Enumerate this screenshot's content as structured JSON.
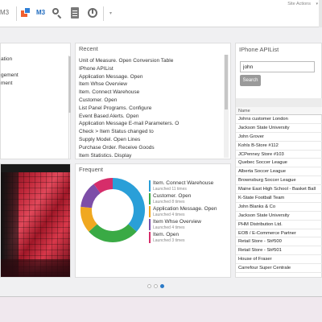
{
  "topbar": {
    "app_label_left": "M3",
    "app_label": "M3",
    "site_actions": "Site Actions",
    "site_actions_arrow": "▾",
    "menu_chevron": "▾"
  },
  "left_panel": {
    "items": [
      "ation",
      "",
      "gement",
      "ment"
    ]
  },
  "recent": {
    "title": "Recent",
    "items": [
      "Unit of Measure. Open Conversion Table",
      "IPhone APIList",
      "Application Message. Open",
      "Item Whse Overview",
      "Item. Connect Warehouse",
      "Customer. Open",
      "List Panel Programs. Configure",
      "Event Based Alerts. Open",
      "Application Message E-mail Parameters. O",
      "Check > Item Status changed to",
      "Supply Model. Open Lines",
      "Purchase Order. Receive Goods",
      "Item Statistics. Display"
    ]
  },
  "frequent": {
    "title": "Frequent",
    "items": [
      {
        "name": "Item. Connect Warehouse",
        "sub": "Launched 11 times",
        "count": 11,
        "color": "#2a9fd8"
      },
      {
        "name": "Customer. Open",
        "sub": "Launched 8 times",
        "count": 8,
        "color": "#3aaa45"
      },
      {
        "name": "Application Message. Open",
        "sub": "Launched 4 times",
        "count": 4,
        "color": "#f0a820"
      },
      {
        "name": "Item Whse Overview",
        "sub": "Launched 4 times",
        "count": 4,
        "color": "#7d4ea8"
      },
      {
        "name": "Item. Open",
        "sub": "Launched 3 times",
        "count": 3,
        "color": "#d62d6a"
      }
    ]
  },
  "iphone": {
    "title": "IPhone APIList",
    "search_value": "john",
    "search_button": "Search",
    "column_header": "Name",
    "rows": [
      "Johns customer London",
      "Jackson State University",
      "John Grover",
      "Kohls B-Store #112",
      "JCPenney Store #103",
      "Quebec Soccer League",
      "Alberta Soccer League",
      "Brownsburg Soccer League",
      "Maine East High School - Basket Ball",
      "K-State Football Team",
      "John Blanks & Co",
      "Jackson State University",
      "PHM Distribution Ltd.",
      "EOB / E-Commerce Partner",
      "Retail Store - St#500",
      "Retail Store - St#501",
      "House of Fraser",
      "Carrefour Super Centrale"
    ]
  },
  "pager": {
    "pages": 3,
    "active": 2
  }
}
